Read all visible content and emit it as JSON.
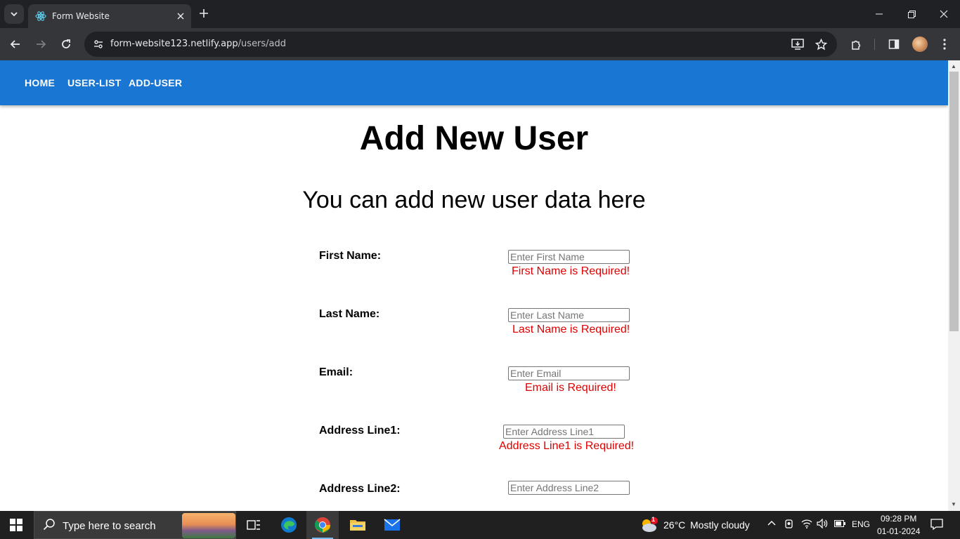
{
  "browser": {
    "tab_title": "Form Website",
    "url_host": "form-website123.netlify.app",
    "url_path": "/users/add",
    "icons": {
      "tab_search": "chevron-down-icon",
      "favicon": "react-icon",
      "close": "close-icon",
      "new_tab": "plus-icon",
      "back": "back-arrow-icon",
      "forward": "forward-arrow-icon",
      "reload": "reload-icon",
      "site_info": "tune-icon",
      "install": "install-app-icon",
      "bookmark": "star-icon",
      "extensions": "puzzle-icon",
      "side_panel": "side-panel-icon",
      "menu": "kebab-menu-icon"
    }
  },
  "nav": {
    "home": "HOME",
    "user_list": "USER-LIST",
    "add_user": "ADD-USER"
  },
  "page": {
    "title": "Add New User",
    "subtitle": "You can add new user data here"
  },
  "form": {
    "first_name": {
      "label": "First Name:",
      "placeholder": "Enter First Name",
      "value": "",
      "error": "First Name is Required!"
    },
    "last_name": {
      "label": "Last Name:",
      "placeholder": "Enter Last Name",
      "value": "",
      "error": "Last Name is Required!"
    },
    "email": {
      "label": "Email:",
      "placeholder": "Enter Email",
      "value": "",
      "error": "Email is Required!"
    },
    "address1": {
      "label": "Address Line1:",
      "placeholder": "Enter Address Line1",
      "value": "",
      "error": "Address Line1 is Required!"
    },
    "address2": {
      "label": "Address Line2:",
      "placeholder": "Enter Address Line2",
      "value": ""
    }
  },
  "taskbar": {
    "search_placeholder": "Type here to search",
    "weather_temp": "26°C",
    "weather_desc": "Mostly cloudy",
    "weather_badge": "1",
    "language": "ENG",
    "time": "09:28 PM",
    "date": "01-01-2024"
  },
  "colors": {
    "appbar": "#1976d2",
    "error": "#e00000"
  }
}
